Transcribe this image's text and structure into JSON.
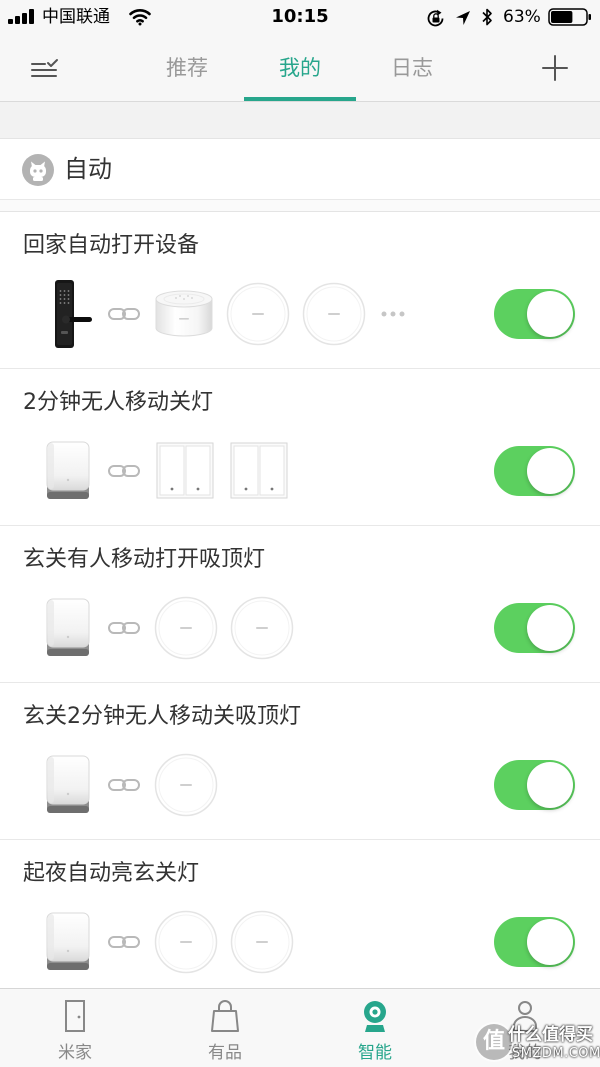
{
  "status_bar": {
    "carrier": "中国联通",
    "time": "10:15",
    "battery_text": "63%",
    "battery_level": 0.63,
    "icons": [
      "signal-icon",
      "wifi-icon",
      "rotation-lock-icon",
      "location-icon",
      "bluetooth-icon",
      "battery-icon"
    ]
  },
  "nav": {
    "menu_icon": "menu-check-icon",
    "tabs": [
      {
        "label": "推荐",
        "active": false
      },
      {
        "label": "我的",
        "active": true
      },
      {
        "label": "日志",
        "active": false
      }
    ],
    "add_icon": "plus-icon"
  },
  "section": {
    "title": "自动",
    "icon": "robot-icon"
  },
  "automations": [
    {
      "title": "回家自动打开设备",
      "enabled": true,
      "devices": [
        "door-lock-icon",
        "link-icon",
        "gateway-icon",
        "ceiling-light-icon",
        "ceiling-light-icon",
        "more-dots-icon"
      ]
    },
    {
      "title": "2分钟无人移动关灯",
      "enabled": true,
      "devices": [
        "motion-sensor-icon",
        "link-icon",
        "wall-switch-icon",
        "wall-switch-icon"
      ]
    },
    {
      "title": "玄关有人移动打开吸顶灯",
      "enabled": true,
      "devices": [
        "motion-sensor-icon",
        "link-icon",
        "ceiling-light-icon",
        "ceiling-light-icon"
      ]
    },
    {
      "title": "玄关2分钟无人移动关吸顶灯",
      "enabled": true,
      "devices": [
        "motion-sensor-icon",
        "link-icon",
        "ceiling-light-icon"
      ]
    },
    {
      "title": "起夜自动亮玄关灯",
      "enabled": true,
      "devices": [
        "motion-sensor-icon",
        "link-icon",
        "ceiling-light-icon",
        "ceiling-light-icon"
      ]
    }
  ],
  "tab_bar": {
    "items": [
      {
        "label": "米家",
        "icon": "door-icon",
        "active": false
      },
      {
        "label": "有品",
        "icon": "bag-icon",
        "active": false
      },
      {
        "label": "智能",
        "icon": "smart-camera-icon",
        "active": true
      },
      {
        "label": "我的",
        "icon": "person-icon",
        "active": false
      }
    ]
  },
  "watermark": {
    "badge": "值",
    "name": "什么值得买",
    "domain": "SMZDM.COM"
  },
  "colors": {
    "accent": "#27a68c",
    "toggle_on": "#5cd05f",
    "text": "#333333",
    "muted": "#999999"
  }
}
